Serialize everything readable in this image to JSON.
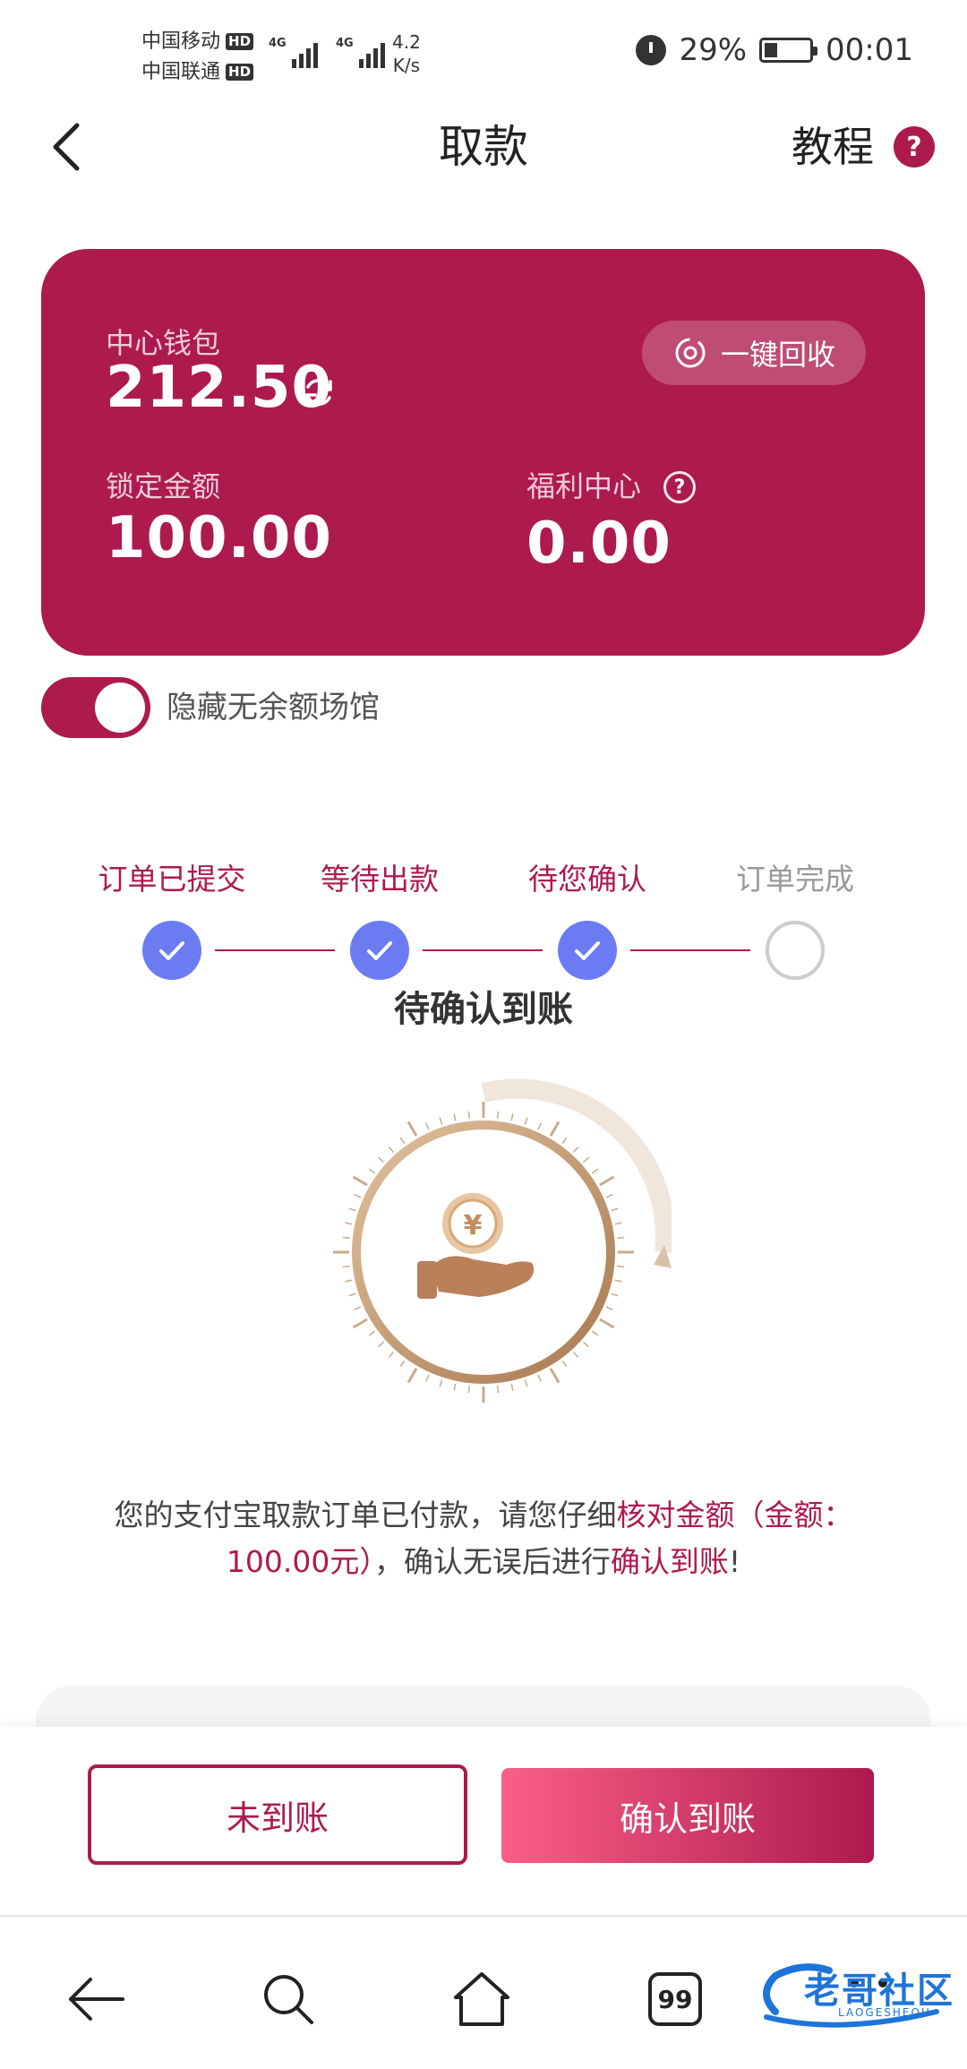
{
  "status_bar": {
    "carrier1": "中国移动",
    "carrier2": "中国联通",
    "hd": "HD",
    "network1": "4G",
    "network2": "4G",
    "speed_value": "4.2",
    "speed_unit": "K/s",
    "battery": "29%",
    "time": "00:01"
  },
  "header": {
    "title": "取款",
    "tutorial_label": "教程",
    "help_symbol": "?"
  },
  "wallet": {
    "center_label": "中心钱包",
    "center_value": "212.50",
    "recycle_label": "一键回收",
    "locked_label": "锁定金额",
    "locked_value": "100.00",
    "welfare_label": "福利中心",
    "welfare_value": "0.00",
    "welfare_help": "?"
  },
  "toggle": {
    "label": "隐藏无余额场馆",
    "on": true
  },
  "steps": [
    {
      "label": "订单已提交",
      "done": true
    },
    {
      "label": "等待出款",
      "done": true
    },
    {
      "label": "待您确认",
      "done": true
    },
    {
      "label": "订单完成",
      "done": false
    }
  ],
  "status_heading": "待确认到账",
  "description": {
    "part1": "您的支付宝取款订单已付款，请您仔细",
    "hl1": "核对金额",
    "hl2": "（金额：100.00元）",
    "part2": "，确认无误后进行",
    "hl3": "确认到账",
    "part3": "!"
  },
  "actions": {
    "not_received": "未到账",
    "confirm": "确认到账"
  },
  "nav": {
    "tabs_count": "99"
  },
  "watermark": {
    "text": "老哥社区",
    "sub": "LAOGESHEQU"
  },
  "colors": {
    "brand": "#ad1a4e",
    "step_done": "#6b7cf3",
    "dial_gold": "#c39a72"
  }
}
